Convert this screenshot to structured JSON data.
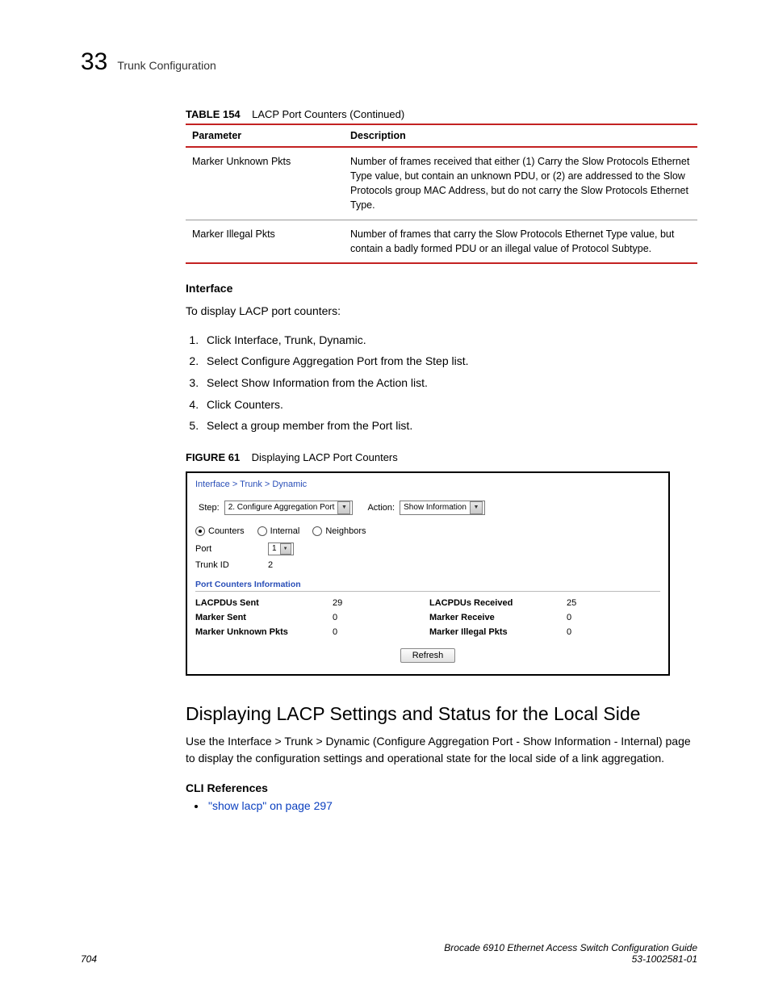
{
  "header": {
    "chapter_number": "33",
    "chapter_title": "Trunk Configuration"
  },
  "table": {
    "caption_label": "TABLE 154",
    "caption_text": "LACP Port Counters (Continued)",
    "col_parameter": "Parameter",
    "col_description": "Description",
    "rows": [
      {
        "param": "Marker Unknown Pkts",
        "desc": "Number of frames received that either (1) Carry the Slow Protocols Ethernet Type value, but contain an unknown PDU, or (2) are addressed to the Slow Protocols group MAC Address, but do not carry the Slow Protocols Ethernet Type."
      },
      {
        "param": "Marker Illegal Pkts",
        "desc": "Number of frames that carry the Slow Protocols Ethernet Type value, but contain a badly formed PDU or an illegal value of Protocol Subtype."
      }
    ]
  },
  "interface": {
    "heading": "Interface",
    "intro": "To display LACP port counters:",
    "steps": [
      "Click Interface, Trunk, Dynamic.",
      "Select Configure Aggregation Port from the Step list.",
      "Select Show Information from the Action list.",
      "Click Counters.",
      "Select a group member from the Port list."
    ]
  },
  "figure": {
    "caption_label": "FIGURE 61",
    "caption_text": "Displaying LACP Port Counters",
    "breadcrumb": "Interface > Trunk > Dynamic",
    "step_label": "Step:",
    "step_value": "2. Configure Aggregation Port",
    "action_label": "Action:",
    "action_value": "Show Information",
    "radio": {
      "counters": "Counters",
      "internal": "Internal",
      "neighbors": "Neighbors"
    },
    "port_label": "Port",
    "port_value": "1",
    "trunk_label": "Trunk ID",
    "trunk_value": "2",
    "pci_heading": "Port Counters Information",
    "stats": {
      "sent_lbl": "LACPDUs Sent",
      "sent_val": "29",
      "recv_lbl": "LACPDUs Received",
      "recv_val": "25",
      "msent_lbl": "Marker Sent",
      "msent_val": "0",
      "mrecv_lbl": "Marker Receive",
      "mrecv_val": "0",
      "munk_lbl": "Marker Unknown Pkts",
      "munk_val": "0",
      "mill_lbl": "Marker Illegal Pkts",
      "mill_val": "0"
    },
    "refresh": "Refresh"
  },
  "section2": {
    "heading": "Displaying LACP Settings and Status for the Local Side",
    "body": "Use the Interface > Trunk > Dynamic (Configure Aggregation Port - Show Information - Internal) page to display the configuration settings and operational state for the local side of a link aggregation.",
    "cli_heading": "CLI References",
    "cli_link": "\"show lacp\" on page 297"
  },
  "footer": {
    "page": "704",
    "doc_title": "Brocade 6910 Ethernet Access Switch Configuration Guide",
    "doc_id": "53-1002581-01"
  }
}
